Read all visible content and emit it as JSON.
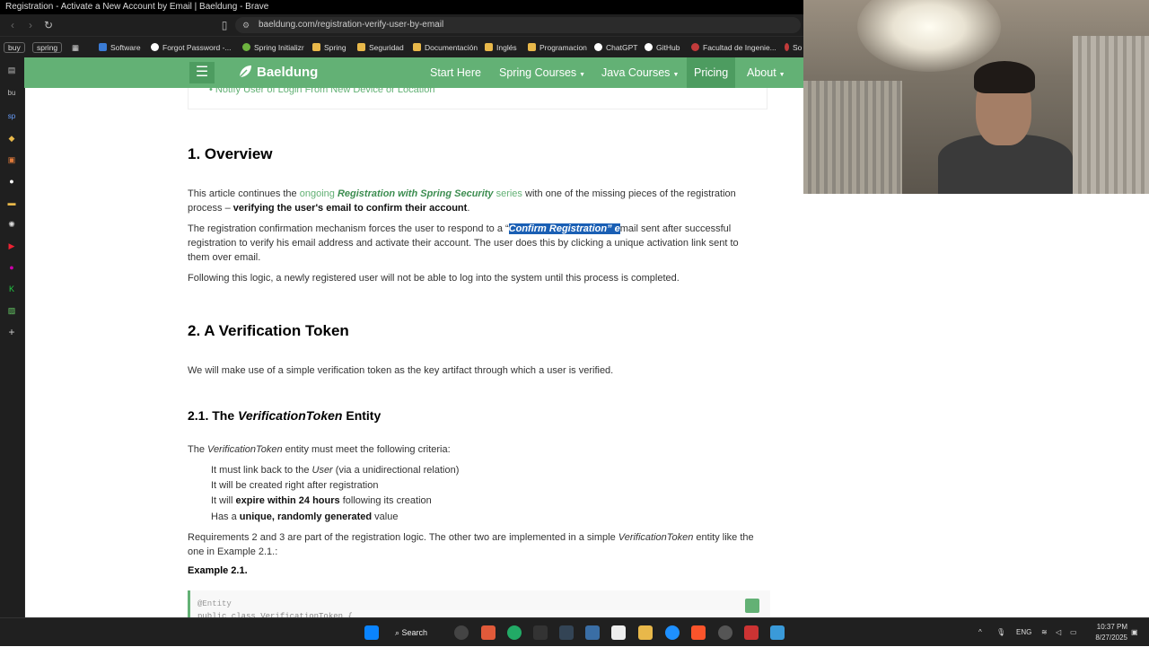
{
  "window": {
    "title": "Registration - Activate a New Account by Email | Baeldung - Brave"
  },
  "browser": {
    "url": "baeldung.com/registration-verify-user-by-email",
    "bookmarks": [
      {
        "label": "buy",
        "color": "#2a2a2a"
      },
      {
        "label": "spring",
        "color": "#2a2a2a"
      },
      {
        "label": "Software",
        "color": "#3a7bd5"
      },
      {
        "label": "Forgot Password -...",
        "color": "#ffffff"
      },
      {
        "label": "Spring Initializr",
        "color": "#6db33f"
      },
      {
        "label": "Spring",
        "color": "#e8b84a"
      },
      {
        "label": "Seguridad",
        "color": "#e8b84a"
      },
      {
        "label": "Documentación",
        "color": "#e8b84a"
      },
      {
        "label": "Inglés",
        "color": "#e8b84a"
      },
      {
        "label": "Programacion",
        "color": "#e8b84a"
      },
      {
        "label": "ChatGPT",
        "color": "#ffffff"
      },
      {
        "label": "GitHub",
        "color": "#ffffff"
      },
      {
        "label": "Facultad de Ingenie...",
        "color": "#c23b3b"
      },
      {
        "label": "So",
        "color": "#c23b3b"
      }
    ],
    "sidebar_labels": [
      "bu",
      "sp"
    ]
  },
  "site": {
    "logo": "Baeldung",
    "nav": {
      "start_here": "Start Here",
      "spring_courses": "Spring Courses",
      "java_courses": "Java Courses",
      "pricing": "Pricing",
      "about": "About"
    },
    "brand_color": "#63b175"
  },
  "article": {
    "toc_tail": "• Notify User of Login From New Device or Location",
    "h_overview": "1. Overview",
    "p1_a": "This article continues the ",
    "p1_link": "ongoing",
    "p1_series": "Registration with Spring Security",
    "p1_b": " series",
    "p1_c": " with one of the missing pieces of the registration process – ",
    "p1_bold": "verifying the user's email to confirm their account",
    "p1_end": ".",
    "p2_a": "The registration confirmation mechanism forces the user to respond to a “",
    "p2_hl": "Confirm Registration” e",
    "p2_b": "mail sent after successful registration to verify his email address and activate their account. The user does this by clicking a unique activation link sent to them over email.",
    "p3": "Following this logic, a newly registered user will not be able to log into the system until this process is completed.",
    "h_token": "2. A Verification Token",
    "p4": "We will make use of a simple verification token as the key artifact through which a user is verified.",
    "h_entity_a": "2.1. The ",
    "h_entity_i": "VerificationToken",
    "h_entity_b": " Entity",
    "p5_a": "The ",
    "p5_i": "VerificationToken",
    "p5_b": " entity must meet the following criteria:",
    "crit1_a": "It must link back to the ",
    "crit1_i": "User",
    "crit1_b": " (via a unidirectional relation)",
    "crit2": "It will be created right after registration",
    "crit3_a": "It will ",
    "crit3_b": "expire within 24 hours",
    "crit3_c": " following its creation",
    "crit4_a": "Has a ",
    "crit4_b": "unique, randomly generated",
    "crit4_c": " value",
    "p6_a": "Requirements 2 and 3 are part of the registration logic. The other two are implemented in a simple ",
    "p6_i": "VerificationToken",
    "p6_b": " entity like the one in Example 2.1.:",
    "example_label": "Example 2.1.",
    "code_line1": "@Entity",
    "code_line2": "public class VerificationToken {"
  },
  "taskbar": {
    "search": "Search",
    "lang": "ENG",
    "time": "10:37 PM",
    "date": "8/27/2025"
  }
}
